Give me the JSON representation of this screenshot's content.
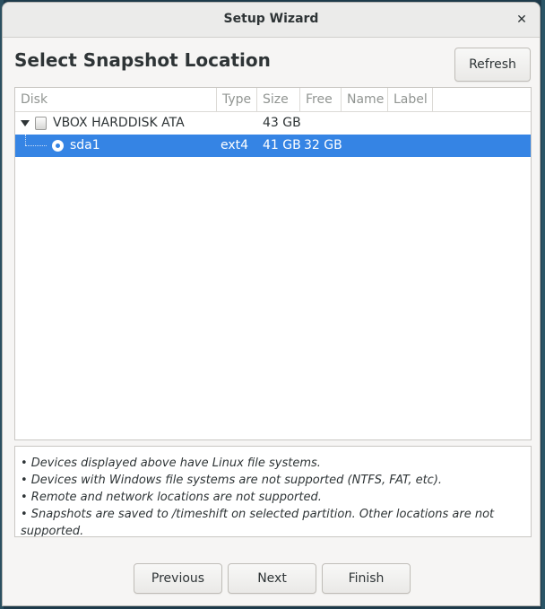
{
  "window": {
    "title": "Setup Wizard",
    "close_glyph": "✕"
  },
  "heading": "Select Snapshot Location",
  "refresh_label": "Refresh",
  "columns": [
    "Disk",
    "Type",
    "Size",
    "Free",
    "Name",
    "Label"
  ],
  "disk": {
    "name": "VBOX HARDDISK ATA",
    "size": "43 GB",
    "icon": "hard-disk-icon"
  },
  "partition": {
    "name": "sda1",
    "type": "ext4",
    "size": "41 GB",
    "free": "32 GB",
    "selected": true
  },
  "notes": [
    "• Devices displayed above have Linux file systems.",
    "• Devices with Windows file systems are not supported (NTFS, FAT, etc).",
    "• Remote and network locations are not supported.",
    "• Snapshots are saved to /timeshift on selected partition. Other locations are not supported."
  ],
  "buttons": {
    "previous": "Previous",
    "next": "Next",
    "finish": "Finish"
  },
  "colors": {
    "selection": "#3584e4",
    "window_bg": "#f6f5f4"
  }
}
